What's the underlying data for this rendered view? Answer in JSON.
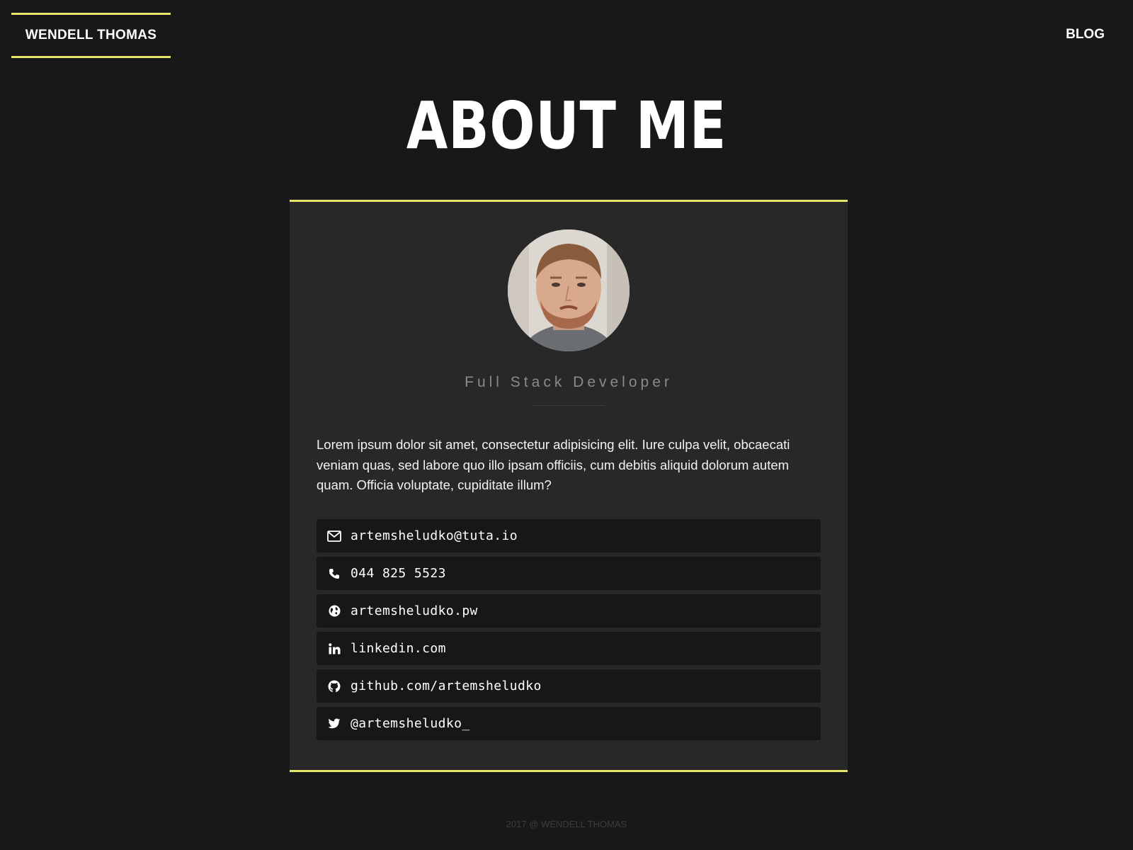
{
  "header": {
    "brand": "WENDELL THOMAS",
    "nav_blog": "BLOG"
  },
  "main": {
    "title": "ABOUT ME",
    "profile": {
      "role": "Full Stack Developer",
      "bio": "Lorem ipsum dolor sit amet, consectetur adipisicing elit. Iure culpa velit, obcaecati veniam quas, sed labore quo illo ipsam officiis, cum debitis aliquid dolorum autem quam. Officia voluptate, cupiditate illum?"
    },
    "contacts": [
      {
        "icon": "envelope-icon",
        "text": "artemsheludko@tuta.io"
      },
      {
        "icon": "phone-icon",
        "text": "044 825 5523"
      },
      {
        "icon": "globe-icon",
        "text": "artemsheludko.pw"
      },
      {
        "icon": "linkedin-icon",
        "text": "linkedin.com"
      },
      {
        "icon": "github-icon",
        "text": "github.com/artemsheludko"
      },
      {
        "icon": "twitter-icon",
        "text": "@artemsheludko_"
      }
    ]
  },
  "footer": {
    "text": "2017 @ WENDELL THOMAS"
  },
  "colors": {
    "background": "#181818",
    "card": "#282828",
    "accent": "#e6e66a",
    "contact_row": "#171717",
    "muted_text": "#8a8a8a"
  }
}
